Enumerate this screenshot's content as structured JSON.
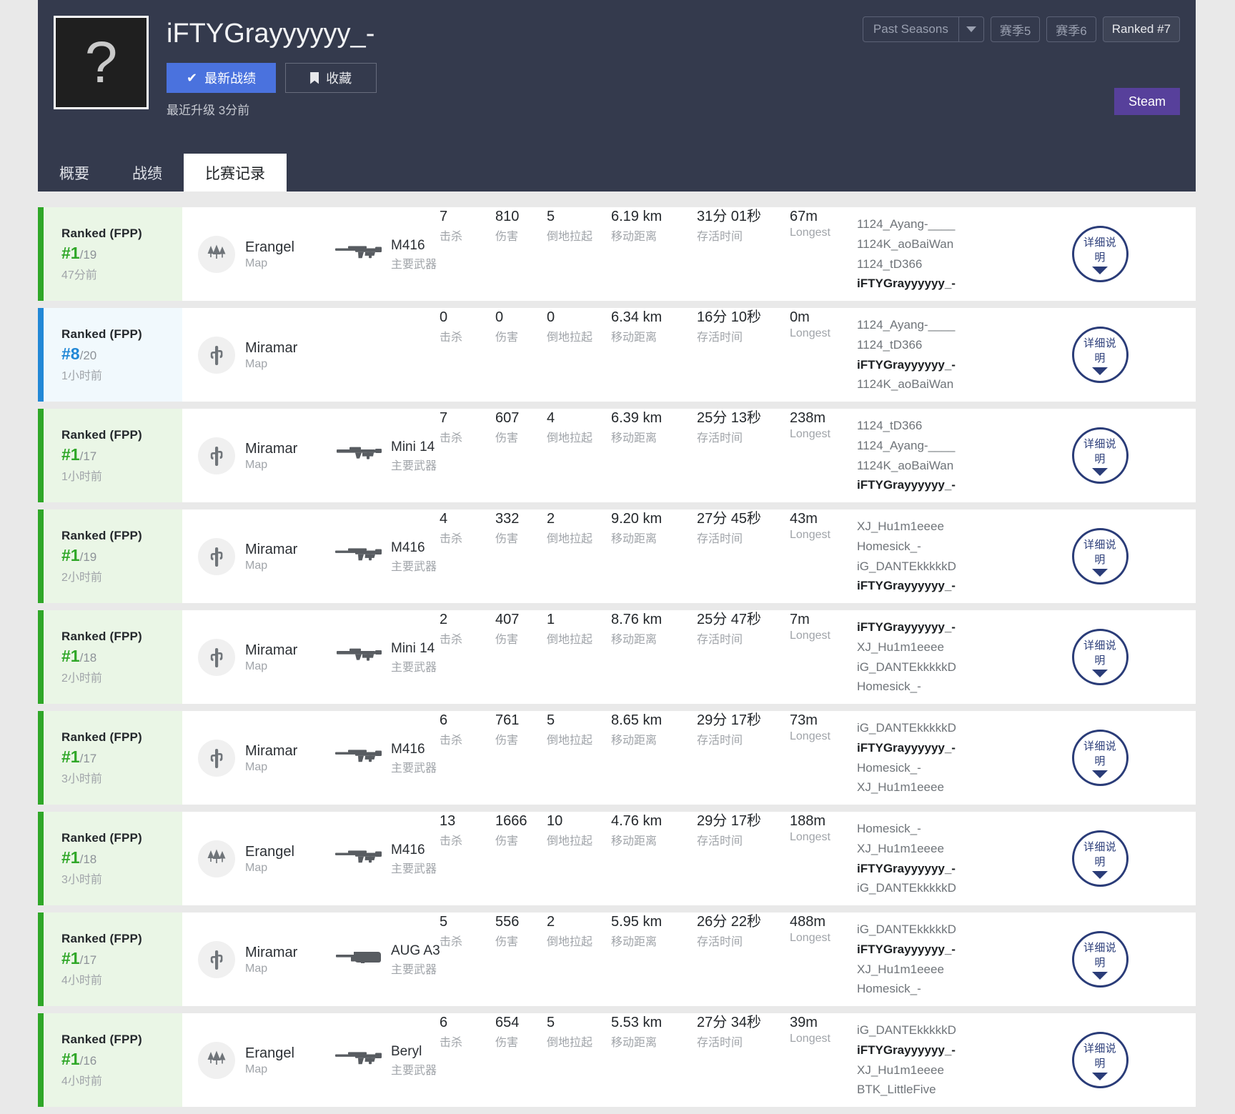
{
  "header": {
    "avatar_glyph": "?",
    "player_name": "iFTYGrayyyyyy_-",
    "btn_latest": "最新战绩",
    "btn_favorite": "收藏",
    "last_update": "最近升级 3分前",
    "season_select_label": "Past Seasons",
    "season_chips": [
      {
        "label": "赛季5",
        "active": false
      },
      {
        "label": "赛季6",
        "active": false
      },
      {
        "label": "Ranked #7",
        "active": true
      }
    ],
    "steam_label": "Steam",
    "tabs": [
      {
        "label": "概要",
        "active": false
      },
      {
        "label": "战绩",
        "active": false
      },
      {
        "label": "比赛记录",
        "active": true
      }
    ],
    "accent_blue": "#4a72de",
    "steam_purple": "#57409b",
    "header_bg": "#343a4d"
  },
  "labels": {
    "map_sub": "Map",
    "weapon_sub": "主要武器",
    "kills": "击杀",
    "damage": "伤害",
    "revives": "倒地拉起",
    "distance": "移动距离",
    "survival": "存活时间",
    "longest": "Longest",
    "detail_button": "详细说明"
  },
  "self_name": "iFTYGrayyyyyy_-",
  "matches": [
    {
      "mode": "Ranked (FPP)",
      "placement": "#1",
      "total": "/19",
      "timeago": "47分前",
      "win": true,
      "map": "Erangel",
      "map_icon": "trees-icon",
      "weapon": "M416",
      "weapon_icon": "assault-rifle-icon",
      "kills": "7",
      "damage": "810",
      "revives": "5",
      "distance": "6.19 km",
      "survival": "31分 01秒",
      "longest": "67m",
      "roster": [
        "1124_Ayang-____",
        "1124K_aoBaiWan",
        "1124_tD366",
        "iFTYGrayyyyyy_-"
      ]
    },
    {
      "mode": "Ranked (FPP)",
      "placement": "#8",
      "total": "/20",
      "timeago": "1小时前",
      "win": false,
      "map": "Miramar",
      "map_icon": "cactus-icon",
      "weapon": "",
      "weapon_icon": "",
      "kills": "0",
      "damage": "0",
      "revives": "0",
      "distance": "6.34 km",
      "survival": "16分 10秒",
      "longest": "0m",
      "roster": [
        "1124_Ayang-____",
        "1124_tD366",
        "iFTYGrayyyyyy_-",
        "1124K_aoBaiWan"
      ]
    },
    {
      "mode": "Ranked (FPP)",
      "placement": "#1",
      "total": "/17",
      "timeago": "1小时前",
      "win": true,
      "map": "Miramar",
      "map_icon": "cactus-icon",
      "weapon": "Mini 14",
      "weapon_icon": "marksman-rifle-icon",
      "kills": "7",
      "damage": "607",
      "revives": "4",
      "distance": "6.39 km",
      "survival": "25分 13秒",
      "longest": "238m",
      "roster": [
        "1124_tD366",
        "1124_Ayang-____",
        "1124K_aoBaiWan",
        "iFTYGrayyyyyy_-"
      ]
    },
    {
      "mode": "Ranked (FPP)",
      "placement": "#1",
      "total": "/19",
      "timeago": "2小时前",
      "win": true,
      "map": "Miramar",
      "map_icon": "cactus-icon",
      "weapon": "M416",
      "weapon_icon": "assault-rifle-icon",
      "kills": "4",
      "damage": "332",
      "revives": "2",
      "distance": "9.20 km",
      "survival": "27分 45秒",
      "longest": "43m",
      "roster": [
        "XJ_Hu1m1eeee",
        "Homesick_-",
        "iG_DANTEkkkkkD",
        "iFTYGrayyyyyy_-"
      ]
    },
    {
      "mode": "Ranked (FPP)",
      "placement": "#1",
      "total": "/18",
      "timeago": "2小时前",
      "win": true,
      "map": "Miramar",
      "map_icon": "cactus-icon",
      "weapon": "Mini 14",
      "weapon_icon": "marksman-rifle-icon",
      "kills": "2",
      "damage": "407",
      "revives": "1",
      "distance": "8.76 km",
      "survival": "25分 47秒",
      "longest": "7m",
      "roster": [
        "iFTYGrayyyyyy_-",
        "XJ_Hu1m1eeee",
        "iG_DANTEkkkkkD",
        "Homesick_-"
      ]
    },
    {
      "mode": "Ranked (FPP)",
      "placement": "#1",
      "total": "/17",
      "timeago": "3小时前",
      "win": true,
      "map": "Miramar",
      "map_icon": "cactus-icon",
      "weapon": "M416",
      "weapon_icon": "assault-rifle-icon",
      "kills": "6",
      "damage": "761",
      "revives": "5",
      "distance": "8.65 km",
      "survival": "29分 17秒",
      "longest": "73m",
      "roster": [
        "iG_DANTEkkkkkD",
        "iFTYGrayyyyyy_-",
        "Homesick_-",
        "XJ_Hu1m1eeee"
      ]
    },
    {
      "mode": "Ranked (FPP)",
      "placement": "#1",
      "total": "/18",
      "timeago": "3小时前",
      "win": true,
      "map": "Erangel",
      "map_icon": "trees-icon",
      "weapon": "M416",
      "weapon_icon": "assault-rifle-icon",
      "kills": "13",
      "damage": "1666",
      "revives": "10",
      "distance": "4.76 km",
      "survival": "29分 17秒",
      "longest": "188m",
      "roster": [
        "Homesick_-",
        "XJ_Hu1m1eeee",
        "iFTYGrayyyyyy_-",
        "iG_DANTEkkkkkD"
      ]
    },
    {
      "mode": "Ranked (FPP)",
      "placement": "#1",
      "total": "/17",
      "timeago": "4小时前",
      "win": true,
      "map": "Miramar",
      "map_icon": "cactus-icon",
      "weapon": "AUG A3",
      "weapon_icon": "bullpup-rifle-icon",
      "kills": "5",
      "damage": "556",
      "revives": "2",
      "distance": "5.95 km",
      "survival": "26分 22秒",
      "longest": "488m",
      "roster": [
        "iG_DANTEkkkkkD",
        "iFTYGrayyyyyy_-",
        "XJ_Hu1m1eeee",
        "Homesick_-"
      ]
    },
    {
      "mode": "Ranked (FPP)",
      "placement": "#1",
      "total": "/16",
      "timeago": "4小时前",
      "win": true,
      "map": "Erangel",
      "map_icon": "trees-icon",
      "weapon": "Beryl",
      "weapon_icon": "assault-rifle-icon",
      "kills": "6",
      "damage": "654",
      "revives": "5",
      "distance": "5.53 km",
      "survival": "27分 34秒",
      "longest": "39m",
      "roster": [
        "iG_DANTEkkkkkD",
        "iFTYGrayyyyyy_-",
        "XJ_Hu1m1eeee",
        "BTK_LittleFive"
      ]
    }
  ]
}
